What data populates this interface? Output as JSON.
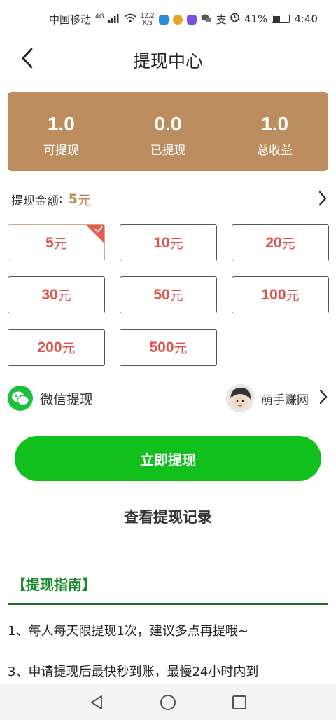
{
  "status_bar": {
    "carrier": "中国移动",
    "network": "4G",
    "speed_value": "12.2",
    "speed_unit": "K/s",
    "battery": "41%",
    "time": "4:40"
  },
  "header": {
    "title": "提现中心"
  },
  "summary": {
    "withdrawable_value": "1.0",
    "withdrawable_label": "可提现",
    "withdrawn_value": "0.0",
    "withdrawn_label": "已提现",
    "total_value": "1.0",
    "total_label": "总收益"
  },
  "amount": {
    "label": "提现金额",
    "colon": ":",
    "value": "5",
    "unit": "元"
  },
  "options": [
    {
      "value": "5",
      "unit": "元",
      "selected": true
    },
    {
      "value": "10",
      "unit": "元"
    },
    {
      "value": "20",
      "unit": "元"
    },
    {
      "value": "30",
      "unit": "元"
    },
    {
      "value": "50",
      "unit": "元"
    },
    {
      "value": "100",
      "unit": "元"
    },
    {
      "value": "200",
      "unit": "元"
    },
    {
      "value": "500",
      "unit": "元"
    }
  ],
  "method": {
    "label": "微信提现",
    "account_name": "萌手赚网"
  },
  "primary_button": "立即提现",
  "records_link": "查看提现记录",
  "guide": {
    "title": "【提现指南】",
    "items": [
      "1、每人每天限提现1次，建议多点再提哦~",
      "3、申请提现后最快秒到账，最慢24小时内到"
    ]
  },
  "colors": {
    "accent_brown": "#bb8d5f",
    "option_text": "#e0534d",
    "primary_green": "#11c01c",
    "guide_green": "#1a8a2e"
  },
  "icons": {
    "back": "chevron-left-icon",
    "chevron": "chevron-right-icon",
    "wechat": "wechat-icon",
    "check": "check-icon"
  }
}
